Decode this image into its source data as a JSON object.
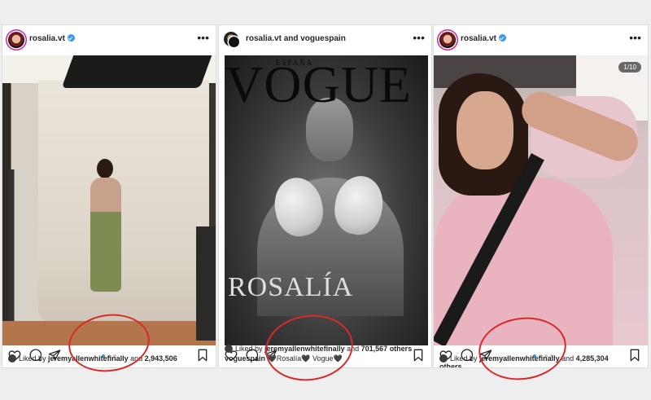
{
  "colors": {
    "verified": "#3897f0",
    "annotation_circle": "#d72a2a",
    "carousel_dot_active": "#3897f0",
    "carousel_dot_inactive": "#c9c9c9"
  },
  "posts": [
    {
      "username": "rosalia.vt",
      "verified": true,
      "icons": [
        "heart-icon",
        "comment-icon",
        "share-icon",
        "save-icon"
      ],
      "carousel_dots": 3,
      "carousel_active": 0,
      "liked_by_prefix": "Liked by",
      "liked_by_user": "jeremyallenwhitefinally",
      "liked_by_and": "and",
      "likes_count": "2,943,506"
    },
    {
      "username": "rosalia.vt and voguespain",
      "verified": false,
      "cover_title": "VOGUE",
      "cover_edition": "ESPAÑA",
      "cover_name": "ROSALÍA",
      "icons": [
        "heart-icon",
        "comment-icon",
        "share-icon",
        "save-icon"
      ],
      "carousel_dots": 0,
      "liked_by_prefix": "Liked by",
      "liked_by_user": "jeremyallenwhitefinally",
      "liked_by_and": "and",
      "likes_count": "701,567 others",
      "caption_user": "voguespain",
      "caption_text": "🖤Rosalía🖤 Vogue🖤"
    },
    {
      "username": "rosalia.vt",
      "verified": true,
      "photo_counter": "1/10",
      "icons": [
        "heart-icon",
        "comment-icon",
        "share-icon",
        "save-icon"
      ],
      "carousel_dots": 4,
      "carousel_active": 0,
      "liked_by_prefix": "Liked by",
      "liked_by_user": "jeremyallenwhitefinally",
      "liked_by_and": "and",
      "likes_count": "4,285,304",
      "likes_suffix": "others"
    }
  ]
}
